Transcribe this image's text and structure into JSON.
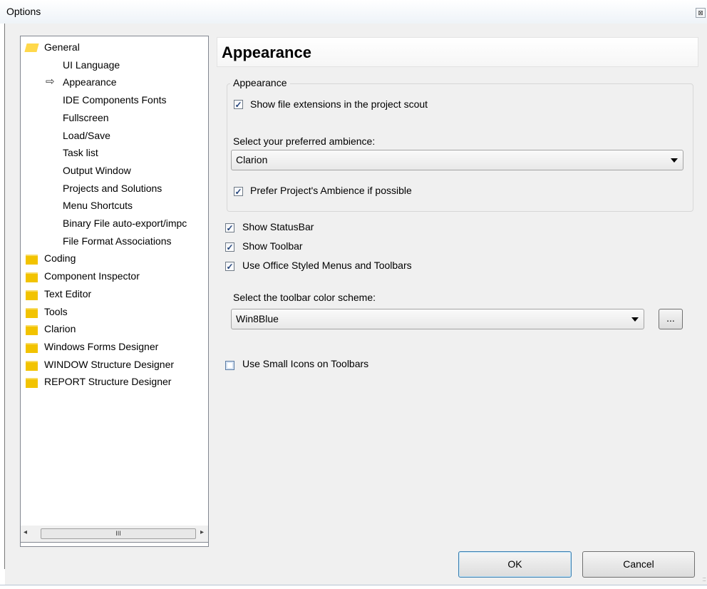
{
  "window": {
    "title": "Options",
    "close_glyph": "⊠"
  },
  "tree": {
    "items": [
      {
        "label": "General",
        "level": 0,
        "icon": "folder-open-icon"
      },
      {
        "label": "UI Language",
        "level": 1
      },
      {
        "label": "Appearance",
        "level": 1,
        "selected": true,
        "marker": "⇨"
      },
      {
        "label": "IDE Components Fonts",
        "level": 1
      },
      {
        "label": "Fullscreen",
        "level": 1
      },
      {
        "label": "Load/Save",
        "level": 1
      },
      {
        "label": "Task list",
        "level": 1
      },
      {
        "label": "Output Window",
        "level": 1
      },
      {
        "label": "Projects and Solutions",
        "level": 1
      },
      {
        "label": "Menu Shortcuts",
        "level": 1
      },
      {
        "label": "Binary File auto-export/impc",
        "level": 1
      },
      {
        "label": "File Format Associations",
        "level": 1
      },
      {
        "label": "Coding",
        "level": 0,
        "icon": "folder-icon"
      },
      {
        "label": "Component Inspector",
        "level": 0,
        "icon": "folder-icon"
      },
      {
        "label": "Text Editor",
        "level": 0,
        "icon": "folder-icon"
      },
      {
        "label": "Tools",
        "level": 0,
        "icon": "folder-icon"
      },
      {
        "label": "Clarion",
        "level": 0,
        "icon": "folder-icon"
      },
      {
        "label": "Windows Forms Designer",
        "level": 0,
        "icon": "folder-icon"
      },
      {
        "label": "WINDOW Structure Designer",
        "level": 0,
        "icon": "folder-icon"
      },
      {
        "label": "REPORT Structure Designer",
        "level": 0,
        "icon": "folder-icon"
      }
    ],
    "scrollbar": {
      "left_arrow": "◂",
      "right_arrow": "▸",
      "thumb_grip": "III"
    }
  },
  "panel": {
    "title": "Appearance",
    "group": {
      "label": "Appearance",
      "show_extensions": {
        "label": "Show file extensions in the project scout",
        "checked": true
      },
      "ambience_label": "Select your preferred ambience:",
      "ambience_value": "Clarion",
      "prefer_project_ambience": {
        "label": "Prefer Project's Ambience if possible",
        "checked": true
      }
    },
    "show_statusbar": {
      "label": "Show StatusBar",
      "checked": true
    },
    "show_toolbar": {
      "label": "Show Toolbar",
      "checked": true
    },
    "office_menus": {
      "label": "Use Office Styled Menus and Toolbars",
      "checked": true
    },
    "color_scheme_label": "Select the toolbar color scheme:",
    "color_scheme_value": "Win8Blue",
    "ellipsis_label": "...",
    "small_icons": {
      "label": "Use Small Icons on Toolbars",
      "checked": false
    }
  },
  "buttons": {
    "ok": "OK",
    "cancel": "Cancel"
  },
  "check_glyph": "✓",
  "resize_grip": ":::"
}
